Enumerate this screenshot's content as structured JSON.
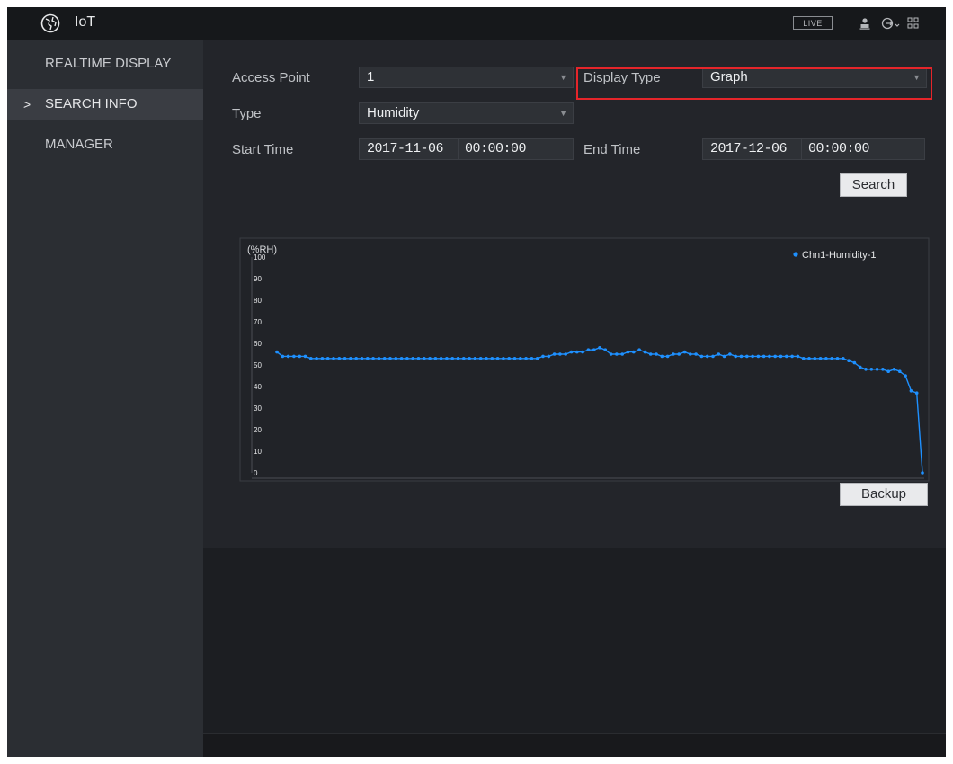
{
  "app": {
    "title": "IoT",
    "logo_icon": "globe-icon"
  },
  "topbar": {
    "live_label": "LIVE",
    "icons": [
      "user-icon",
      "logout-icon",
      "grid-menu-icon"
    ]
  },
  "sidebar": {
    "items": [
      {
        "label": "REALTIME DISPLAY",
        "active": false
      },
      {
        "label": "SEARCH INFO",
        "active": true
      },
      {
        "label": "MANAGER",
        "active": false
      }
    ],
    "active_marker": ">"
  },
  "form": {
    "access_point": {
      "label": "Access Point",
      "value": "1"
    },
    "display_type": {
      "label": "Display Type",
      "value": "Graph"
    },
    "type": {
      "label": "Type",
      "value": "Humidity"
    },
    "start_time": {
      "label": "Start Time",
      "date": "2017-11-06",
      "time": "00:00:00"
    },
    "end_time": {
      "label": "End Time",
      "date": "2017-12-06",
      "time": "00:00:00"
    },
    "search_button": "Search",
    "backup_button": "Backup",
    "highlight_color": "#e5252a"
  },
  "chart_data": {
    "type": "line",
    "ylabel": "(%RH)",
    "ylim": [
      0,
      100
    ],
    "yticks": [
      0,
      10,
      20,
      30,
      40,
      50,
      60,
      70,
      80,
      90,
      100
    ],
    "series": [
      {
        "name": "Chn1-Humidity-1",
        "color": "#1e90ff",
        "values": [
          56,
          54,
          54,
          54,
          54,
          54,
          53,
          53,
          53,
          53,
          53,
          53,
          53,
          53,
          53,
          53,
          53,
          53,
          53,
          53,
          53,
          53,
          53,
          53,
          53,
          53,
          53,
          53,
          53,
          53,
          53,
          53,
          53,
          53,
          53,
          53,
          53,
          53,
          53,
          53,
          53,
          53,
          53,
          53,
          53,
          53,
          53,
          54,
          54,
          55,
          55,
          55,
          56,
          56,
          56,
          57,
          57,
          58,
          57,
          55,
          55,
          55,
          56,
          56,
          57,
          56,
          55,
          55,
          54,
          54,
          55,
          55,
          56,
          55,
          55,
          54,
          54,
          54,
          55,
          54,
          55,
          54,
          54,
          54,
          54,
          54,
          54,
          54,
          54,
          54,
          54,
          54,
          54,
          53,
          53,
          53,
          53,
          53,
          53,
          53,
          53,
          52,
          51,
          49,
          48,
          48,
          48,
          48,
          47,
          48,
          47,
          45,
          38,
          37,
          0
        ]
      }
    ],
    "grid": false,
    "legend_position": "top-right"
  }
}
